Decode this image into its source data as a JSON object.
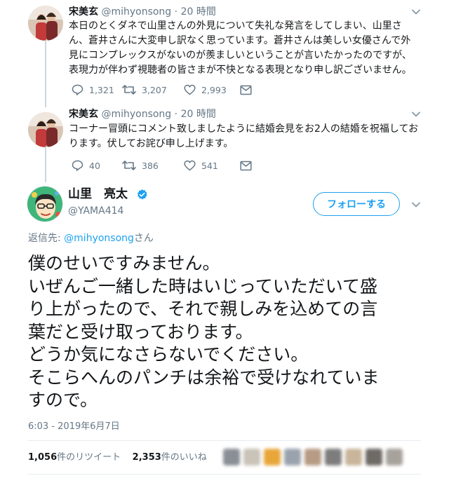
{
  "tweets": [
    {
      "name": "宋美玄",
      "handle": "@mihyonsong",
      "dot": "·",
      "time": "20 時間",
      "lines": [
        "本日のとくダネで山里さんの外見について失礼な発言をしてしまい、山里さ",
        "ん、蒼井さんに大変申し訳なく思っています。蒼井さんは美しい女優さんで外",
        "見にコンプレックスがないのが羨ましいということが言いたかったのですが、",
        "表現力が伴わず視聴者の皆さまが不快となる表現となり申し訳ございません。"
      ],
      "replies": "1,321",
      "retweets": "3,207",
      "likes": "2,993"
    },
    {
      "name": "宋美玄",
      "handle": "@mihyonsong",
      "dot": "·",
      "time": "20 時間",
      "lines": [
        "コーナー冒頭にコメント致しましたように結婚会見をお2人の結婚を祝福してお",
        "ります。伏してお詫び申し上げます。"
      ],
      "replies": "40",
      "retweets": "386",
      "likes": "541"
    }
  ],
  "main": {
    "name": "山里　亮太",
    "handle": "@YAMA414",
    "follow_label": "フォローする",
    "reply_prefix": "返信先: ",
    "reply_mention": "@mihyonsong",
    "reply_suffix": "さん",
    "lines": [
      "僕のせいですみません。",
      "いぜんご一緒した時はいじっていただいて盛",
      "り上がったので、それで親しみを込めての言",
      "葉だと受け取っております。",
      "どうか気になさらないでください。",
      "そこらへんのパンチは余裕で受けなれていま",
      "すので。"
    ],
    "timestamp": "6:03 - 2019年6月7日",
    "retweet_count": "1,056",
    "retweet_label": "件のリツイート",
    "like_count": "2,353",
    "like_label": "件のいいね"
  },
  "colors": {
    "accent": "#1da1f2",
    "text": "#14171a",
    "muted": "#657786",
    "border": "#e6ecf0"
  },
  "icons": [
    "reply-icon",
    "retweet-icon",
    "like-icon",
    "message-icon",
    "chevron-down-icon",
    "verified-badge-icon"
  ]
}
